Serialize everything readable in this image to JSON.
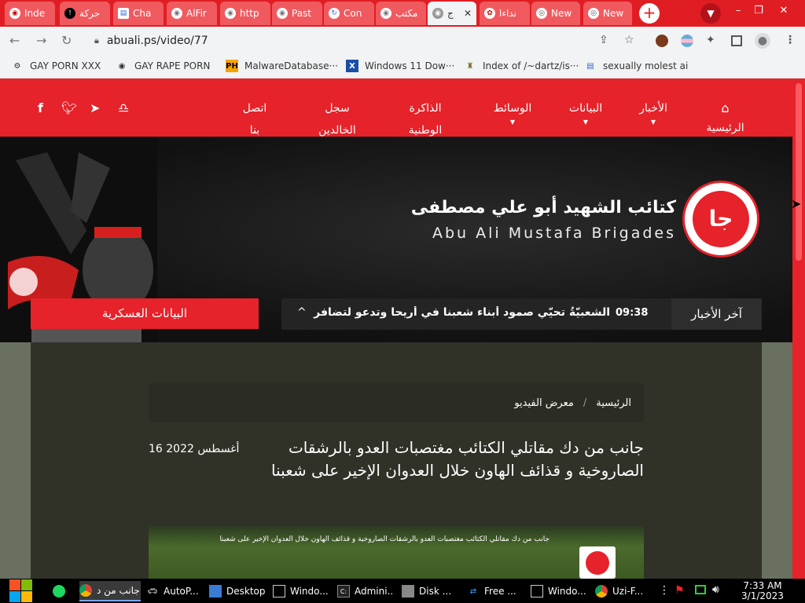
{
  "tabs": [
    {
      "label": "Inde",
      "icon": "globe"
    },
    {
      "label": "حركة",
      "icon": "alert"
    },
    {
      "label": "Cha",
      "icon": "doc"
    },
    {
      "label": "AlFir",
      "icon": "globe"
    },
    {
      "label": "http",
      "icon": "globe"
    },
    {
      "label": "Past",
      "icon": "globe"
    },
    {
      "label": "Con",
      "icon": "refresh"
    },
    {
      "label": "مكتب",
      "icon": "globe"
    },
    {
      "label": "ج",
      "icon": "globe",
      "active": true
    },
    {
      "label": "نداءا",
      "icon": "emblem"
    },
    {
      "label": "New",
      "icon": "chrome"
    },
    {
      "label": "New",
      "icon": "chrome"
    }
  ],
  "browser": {
    "url": "abuali.ps/video/77",
    "new_tab": "+",
    "back": "←",
    "forward": "→",
    "reload": "↻",
    "share": "⇪",
    "star": "☆",
    "extensions": "✦",
    "profile": "●",
    "minimize": "–",
    "restore": "❐",
    "close": "✕"
  },
  "bookmarks": [
    {
      "label": "GAY PORN XXX",
      "icon": "gear"
    },
    {
      "label": "GAY RAPE PORN",
      "icon": "globe"
    },
    {
      "label": "MalwareDatabase···",
      "icon": "PH"
    },
    {
      "label": "Windows 11 Dow···",
      "icon": "X"
    },
    {
      "label": "Index of /~dartz/is···",
      "icon": "folder"
    },
    {
      "label": "sexually molest ai",
      "icon": "doc"
    }
  ],
  "nav": {
    "home": "الرئيسية",
    "news": "الأخبار",
    "statements": "البيانات",
    "media": "الوسائط",
    "memory_1": "الذاكرة",
    "memory_2": "الوطنية",
    "martyrs_1": "سجل",
    "martyrs_2": "الخالدين",
    "contact_1": "اتصل",
    "contact_2": "بنا"
  },
  "brand": {
    "arabic": "كتائب الشهيد أبو علي مصطفى",
    "english": "Abu Ali Mustafa Brigades",
    "logo_glyph": "جا"
  },
  "ticker": {
    "label": "آخر الأخبار",
    "time": "09:38",
    "text": "الشعبيّةُ تحيّي صمود أبناء شعبنا في أريحا وتدعو لتضافر",
    "arrow": "^"
  },
  "military_button": "البيانات العسكرية",
  "breadcrumb": {
    "home": "الرئيسية",
    "separator": "/",
    "current": "معرض الفيديو"
  },
  "video": {
    "title": "جانب من دك مقاتلي الكتائب مغتصبات العدو بالرشقات الصاروخية و قذائف الهاون خلال العدوان الإخير على شعبنا",
    "date": "16 أغسطس 2022",
    "thumb_caption": "جانب من دك مقاتلي الكتائب مغتصبات العدو بالرشقات الصاروخية و قذائف الهاون خلال العدوان الإخير على شعبنا"
  },
  "taskbar": [
    {
      "label": "جانب من د...",
      "icon": "chrome",
      "active": true
    },
    {
      "label": "AutoP...",
      "icon": "car"
    },
    {
      "label": "Desktop",
      "icon": "monitor"
    },
    {
      "label": "Windo...",
      "icon": "window"
    },
    {
      "label": "Admini...",
      "icon": "cmd"
    },
    {
      "label": "Disk ...",
      "icon": "disk"
    },
    {
      "label": "Free ...",
      "icon": "arrows"
    },
    {
      "label": "Windo...",
      "icon": "window"
    },
    {
      "label": "Uzi-F...",
      "icon": "chrome"
    }
  ],
  "clock": {
    "time": "7:33 AM",
    "date": "3/1/2023"
  }
}
